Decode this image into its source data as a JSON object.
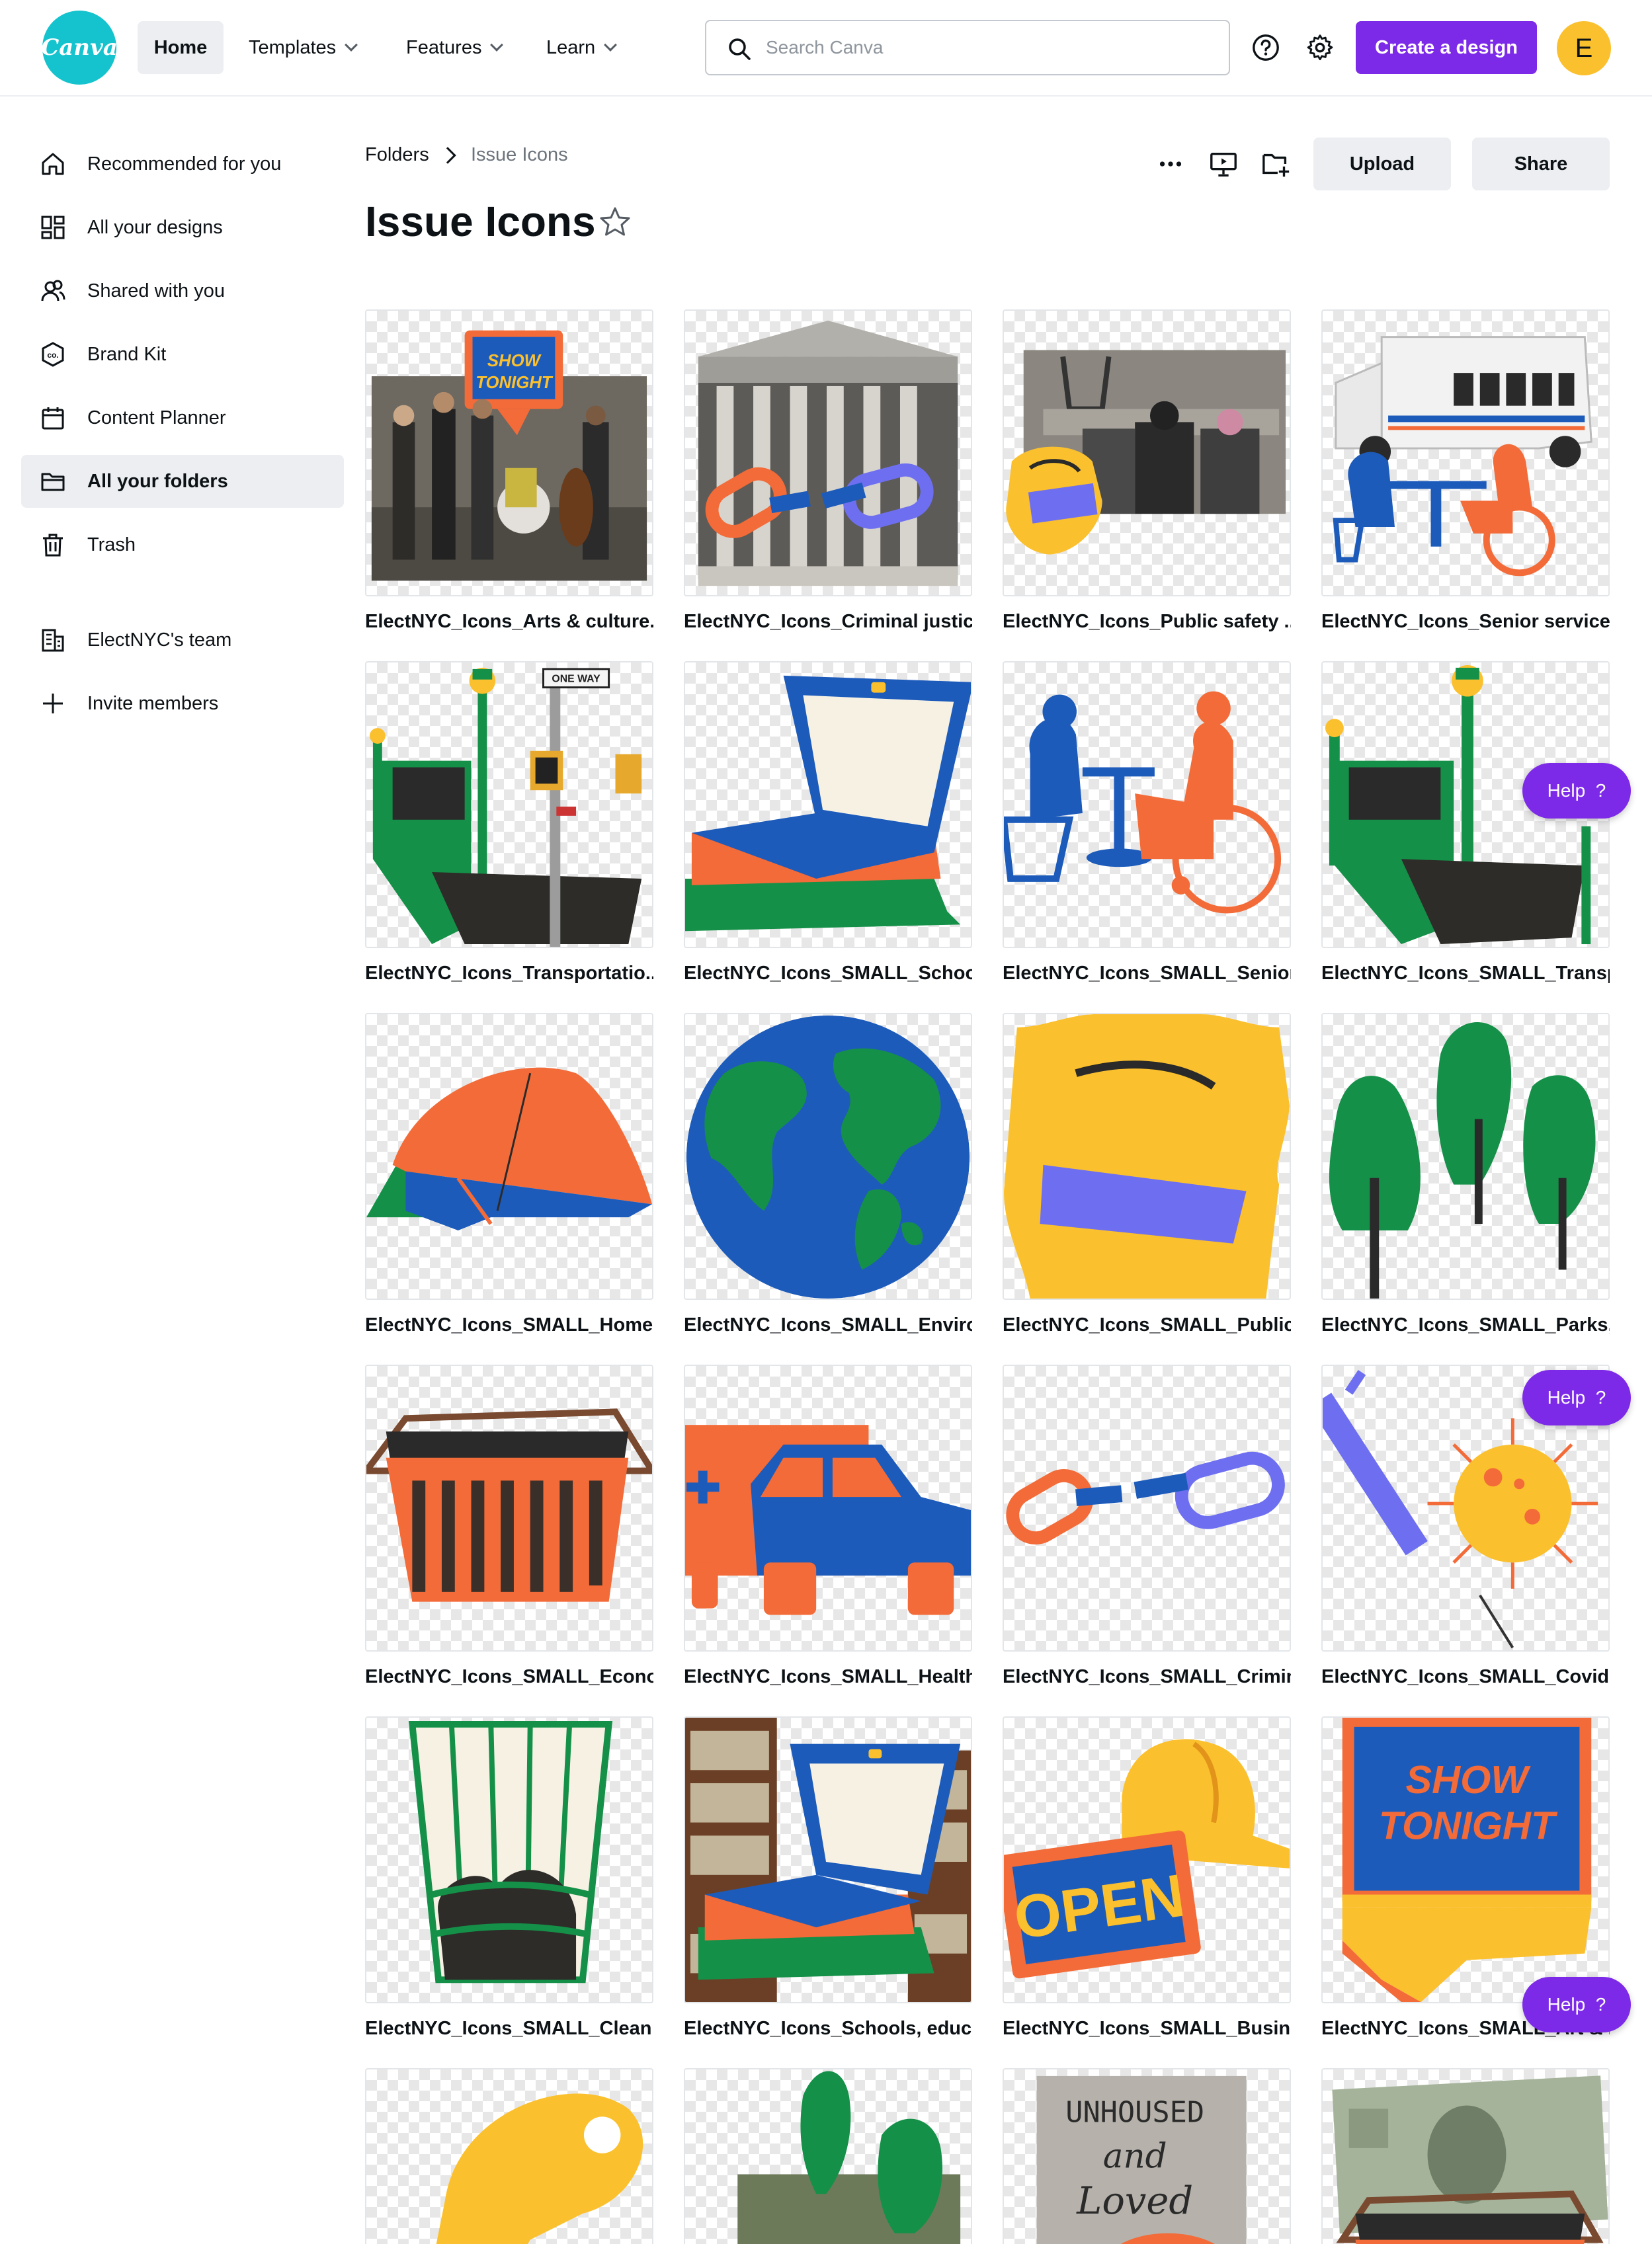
{
  "header": {
    "logo_text": "Canva",
    "nav": [
      {
        "label": "Home"
      },
      {
        "label": "Templates"
      },
      {
        "label": "Features"
      },
      {
        "label": "Learn"
      }
    ],
    "search_placeholder": "Search Canva",
    "create_label": "Create a design",
    "avatar_letter": "E",
    "accent_color": "#7d2ae8"
  },
  "sidebar": {
    "items": [
      {
        "label": "Recommended for you",
        "icon": "home-icon"
      },
      {
        "label": "All your designs",
        "icon": "grid-icon"
      },
      {
        "label": "Shared with you",
        "icon": "people-icon"
      },
      {
        "label": "Brand Kit",
        "icon": "brand-kit-icon"
      },
      {
        "label": "Content Planner",
        "icon": "calendar-icon"
      },
      {
        "label": "All your folders",
        "icon": "folder-icon"
      },
      {
        "label": "Trash",
        "icon": "trash-icon"
      },
      {
        "label": "ElectNYC's team",
        "icon": "building-icon"
      },
      {
        "label": "Invite members",
        "icon": "plus-icon"
      }
    ]
  },
  "breadcrumb": {
    "root": "Folders",
    "current": "Issue Icons"
  },
  "page_title": "Issue Icons",
  "actions": {
    "upload_label": "Upload",
    "share_label": "Share"
  },
  "help_label": "Help",
  "help_mark": "?",
  "items": [
    {
      "title": "ElectNYC_Icons_Arts & culture...."
    },
    {
      "title": "ElectNYC_Icons_Criminal justic..."
    },
    {
      "title": "ElectNYC_Icons_Public safety ..."
    },
    {
      "title": "ElectNYC_Icons_Senior service..."
    },
    {
      "title": "ElectNYC_Icons_Transportatio..."
    },
    {
      "title": "ElectNYC_Icons_SMALL_School..."
    },
    {
      "title": "ElectNYC_Icons_SMALL_Senior..."
    },
    {
      "title": "ElectNYC_Icons_SMALL_Transp..."
    },
    {
      "title": "ElectNYC_Icons_SMALL_Homel..."
    },
    {
      "title": "ElectNYC_Icons_SMALL_Enviro..."
    },
    {
      "title": "ElectNYC_Icons_SMALL_Public ..."
    },
    {
      "title": "ElectNYC_Icons_SMALL_Parks, ..."
    },
    {
      "title": "ElectNYC_Icons_SMALL_Econo..."
    },
    {
      "title": "ElectNYC_Icons_SMALL_Health..."
    },
    {
      "title": "ElectNYC_Icons_SMALL_Crimin..."
    },
    {
      "title": "ElectNYC_Icons_SMALL_Covid ..."
    },
    {
      "title": "ElectNYC_Icons_SMALL_Clean ..."
    },
    {
      "title": "ElectNYC_Icons_Schools, educ..."
    },
    {
      "title": "ElectNYC_Icons_SMALL_Busine..."
    },
    {
      "title": "ElectNYC_Icons_SMALL_Art & ..."
    }
  ],
  "thumb_text": {
    "show": "SHOW",
    "tonight": "TONIGHT",
    "open": "OPEN",
    "one_way": "ONE WAY",
    "unhoused": "UNHOUSED",
    "and": "and",
    "loved": "Loved"
  }
}
